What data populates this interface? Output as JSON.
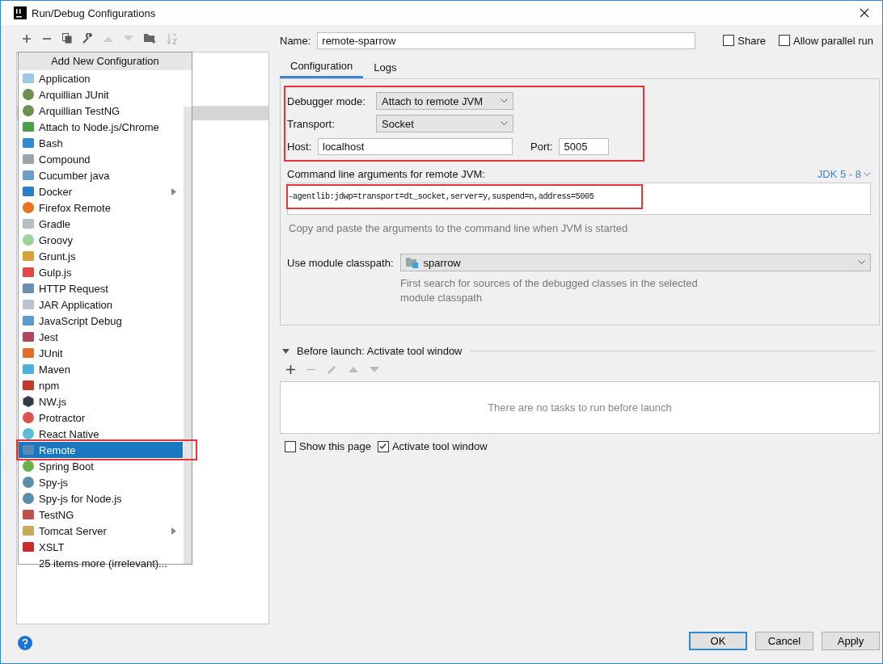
{
  "window": {
    "title": "Run/Debug Configurations"
  },
  "popup": {
    "title": "Add New Configuration",
    "items": [
      {
        "label": "Application",
        "kind": "type",
        "submenu": false,
        "selected": false,
        "highlighted": false
      },
      {
        "label": "Arquillian JUnit",
        "kind": "type",
        "submenu": false,
        "selected": false,
        "highlighted": false
      },
      {
        "label": "Arquillian TestNG",
        "kind": "type",
        "submenu": false,
        "selected": false,
        "highlighted": false
      },
      {
        "label": "Attach to Node.js/Chrome",
        "kind": "type",
        "submenu": false,
        "selected": false,
        "highlighted": false
      },
      {
        "label": "Bash",
        "kind": "type",
        "submenu": false,
        "selected": false,
        "highlighted": false
      },
      {
        "label": "Compound",
        "kind": "type",
        "submenu": false,
        "selected": false,
        "highlighted": false
      },
      {
        "label": "Cucumber java",
        "kind": "type",
        "submenu": false,
        "selected": false,
        "highlighted": false
      },
      {
        "label": "Docker",
        "kind": "type",
        "submenu": true,
        "selected": false,
        "highlighted": false
      },
      {
        "label": "Firefox Remote",
        "kind": "type",
        "submenu": false,
        "selected": false,
        "highlighted": false
      },
      {
        "label": "Gradle",
        "kind": "type",
        "submenu": false,
        "selected": false,
        "highlighted": false
      },
      {
        "label": "Groovy",
        "kind": "type",
        "submenu": false,
        "selected": false,
        "highlighted": false
      },
      {
        "label": "Grunt.js",
        "kind": "type",
        "submenu": false,
        "selected": false,
        "highlighted": false
      },
      {
        "label": "Gulp.js",
        "kind": "type",
        "submenu": false,
        "selected": false,
        "highlighted": false
      },
      {
        "label": "HTTP Request",
        "kind": "type",
        "submenu": false,
        "selected": false,
        "highlighted": false
      },
      {
        "label": "JAR Application",
        "kind": "type",
        "submenu": false,
        "selected": false,
        "highlighted": false
      },
      {
        "label": "JavaScript Debug",
        "kind": "type",
        "submenu": false,
        "selected": false,
        "highlighted": false
      },
      {
        "label": "Jest",
        "kind": "type",
        "submenu": false,
        "selected": false,
        "highlighted": false
      },
      {
        "label": "JUnit",
        "kind": "type",
        "submenu": false,
        "selected": false,
        "highlighted": false
      },
      {
        "label": "Maven",
        "kind": "type",
        "submenu": false,
        "selected": false,
        "highlighted": false
      },
      {
        "label": "npm",
        "kind": "type",
        "submenu": false,
        "selected": false,
        "highlighted": false
      },
      {
        "label": "NW.js",
        "kind": "type",
        "submenu": false,
        "selected": false,
        "highlighted": false
      },
      {
        "label": "Protractor",
        "kind": "type",
        "submenu": false,
        "selected": false,
        "highlighted": false
      },
      {
        "label": "React Native",
        "kind": "type",
        "submenu": false,
        "selected": false,
        "highlighted": false
      },
      {
        "label": "Remote",
        "kind": "type",
        "submenu": false,
        "selected": true,
        "highlighted": true
      },
      {
        "label": "Spring Boot",
        "kind": "type",
        "submenu": false,
        "selected": false,
        "highlighted": false
      },
      {
        "label": "Spy-js",
        "kind": "type",
        "submenu": false,
        "selected": false,
        "highlighted": false
      },
      {
        "label": "Spy-js for Node.js",
        "kind": "type",
        "submenu": false,
        "selected": false,
        "highlighted": false
      },
      {
        "label": "TestNG",
        "kind": "type",
        "submenu": false,
        "selected": false,
        "highlighted": false
      },
      {
        "label": "Tomcat Server",
        "kind": "type",
        "submenu": true,
        "selected": false,
        "highlighted": false
      },
      {
        "label": "XSLT",
        "kind": "type",
        "submenu": false,
        "selected": false,
        "highlighted": false
      },
      {
        "label": "25 items more (irrelevant)...",
        "kind": "more",
        "submenu": false,
        "selected": false,
        "highlighted": false
      }
    ]
  },
  "name": {
    "label": "Name:",
    "value": "remote-sparrow"
  },
  "options": [
    {
      "label": "Share",
      "checked": false
    },
    {
      "label": "Allow parallel run",
      "checked": false
    }
  ],
  "tabs": [
    {
      "label": "Configuration",
      "selected": true
    },
    {
      "label": "Logs",
      "selected": false
    }
  ],
  "connection": {
    "highlighted": true,
    "debugger_mode": {
      "label": "Debugger mode:",
      "value": "Attach to remote JVM"
    },
    "transport": {
      "label": "Transport:",
      "value": "Socket"
    },
    "host": {
      "label": "Host:",
      "value": "localhost"
    },
    "port": {
      "label": "Port:",
      "value": "5005"
    }
  },
  "command": {
    "label": "Command line arguments for remote JVM:",
    "jdk_link": "JDK 5 - 8",
    "value": "-agentlib:jdwp=transport=dt_socket,server=y,suspend=n,address=5005",
    "highlighted": true,
    "hint": "Copy and paste the arguments to the command line when JVM is started"
  },
  "module": {
    "label": "Use module classpath:",
    "value": "sparrow",
    "hint": "First search for sources of the debugged classes in the selected module classpath"
  },
  "before_launch": {
    "title": "Before launch: Activate tool window",
    "expanded": true,
    "empty_text": "There are no tasks to run before launch"
  },
  "bottom_options": [
    {
      "label": "Show this page",
      "checked": false
    },
    {
      "label": "Activate tool window",
      "checked": true
    }
  ],
  "buttons": [
    {
      "label": "OK",
      "default": true
    },
    {
      "label": "Cancel",
      "default": false
    },
    {
      "label": "Apply",
      "default": false
    }
  ]
}
